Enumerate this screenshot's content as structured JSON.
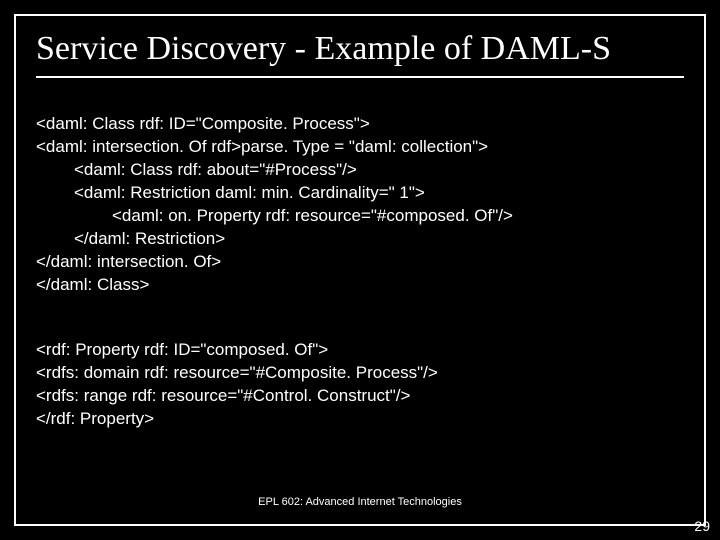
{
  "title": "Service Discovery - Example of DAML-S",
  "code": {
    "l1": "<daml: Class rdf: ID=\"Composite. Process\">",
    "l2": "<daml: intersection. Of rdf>parse. Type = \"daml: collection\">",
    "l3": "<daml: Class rdf: about=\"#Process\"/>",
    "l4": "<daml: Restriction daml: min. Cardinality=\" 1\">",
    "l5": "<daml: on. Property rdf: resource=\"#composed. Of\"/>",
    "l6": "</daml: Restriction>",
    "l7": "</daml: intersection. Of>",
    "l8": "</daml: Class>",
    "l9": "<rdf: Property rdf: ID=\"composed. Of\">",
    "l10": "<rdfs: domain rdf: resource=\"#Composite. Process\"/>",
    "l11": "<rdfs: range rdf: resource=\"#Control. Construct\"/>",
    "l12": "</rdf: Property>"
  },
  "footer": "EPL 602: Advanced Internet Technologies",
  "page": "29"
}
